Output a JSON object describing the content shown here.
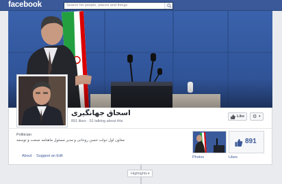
{
  "topbar": {
    "logo": "facebook",
    "search_placeholder": "Search for people, places and things"
  },
  "page": {
    "name": "اسحاق جهانگیری",
    "stats": "891 likes · 91 talking about this",
    "category": "Politician",
    "about": "معاون اول دولت حسن روحانی و مدیر مسئول ماهنامه صنعت و توسعه"
  },
  "buttons": {
    "like_label": "Like",
    "gear_caret": "▾"
  },
  "tabs": {
    "about": "About",
    "separator": "·",
    "suggest_edit": "Suggest an Edit"
  },
  "sidebar": {
    "likes_count": "891",
    "photos_label": "Photos",
    "likes_label": "Likes"
  },
  "timeline": {
    "highlights_label": "Highlights",
    "highlights_caret": "▾"
  },
  "colors": {
    "brand": "#3b5998",
    "cover_bg": "#34569a"
  }
}
